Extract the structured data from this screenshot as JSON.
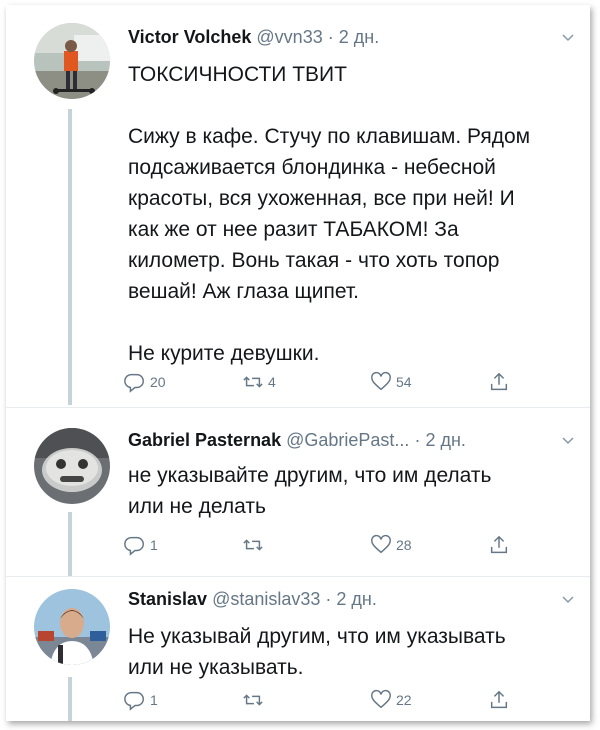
{
  "tweets": [
    {
      "name": "Victor Volchek",
      "handle": "@vvn33",
      "separator": "·",
      "time": "2 дн.",
      "lines": [
        "ТОКСИЧНОСТИ ТВИТ",
        "",
        "Сижу в кафе. Стучу по клавишам. Рядом",
        "подсаживается блондинка - небесной",
        "красоты, вся ухоженная, все при ней! И",
        "как же от нее разит ТАБАКОМ! За",
        "километр. Вонь такая - что хоть топор",
        "вешай! Аж глаза щипет.",
        "",
        "Не курите девушки."
      ],
      "reply_count": "20",
      "retweet_count": "4",
      "like_count": "54"
    },
    {
      "name": "Gabriel Pasternak",
      "handle": "@GabriePast...",
      "separator": "·",
      "time": "2 дн.",
      "lines": [
        "не указывайте другим, что им делать",
        "или не делать"
      ],
      "reply_count": "1",
      "retweet_count": "",
      "like_count": "28"
    },
    {
      "name": "Stanislav",
      "handle": "@stanislav33",
      "separator": "·",
      "time": "2 дн.",
      "lines": [
        "Не указывай другим, что им указывать",
        "или не указывать."
      ],
      "reply_count": "1",
      "retweet_count": "",
      "like_count": "22"
    }
  ],
  "icons": {
    "reply": "reply-icon",
    "retweet": "retweet-icon",
    "like": "heart-icon",
    "share": "share-icon",
    "menu": "chevron-down-icon"
  },
  "colors": {
    "text": "#14171a",
    "muted": "#657786",
    "thread_line": "#c6d2da"
  }
}
